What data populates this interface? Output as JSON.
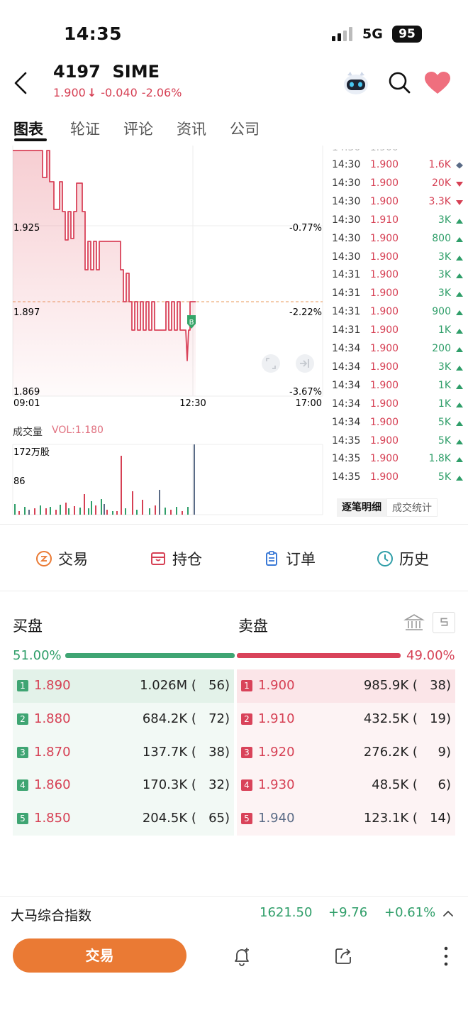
{
  "status_bar": {
    "time": "14:35",
    "network": "5G",
    "battery": "95"
  },
  "header": {
    "code": "4197  SIME",
    "price": "1.900",
    "arrow": "↓",
    "change": "-0.040",
    "change_pct": "-2.06%"
  },
  "tabs": [
    "图表",
    "轮证",
    "评论",
    "资讯",
    "公司"
  ],
  "price_chart": {
    "y_labels": [
      "1.925",
      "1.897",
      "1.869"
    ],
    "y_pct_labels": [
      "-0.77%",
      "-2.22%",
      "-3.67%"
    ],
    "x_labels": [
      "09:01",
      "12:30",
      "17:00"
    ],
    "marker": "B"
  },
  "volume": {
    "title": "成交量",
    "value": "VOL:1.180",
    "y_labels": [
      "172万股",
      "86"
    ]
  },
  "ticks": [
    {
      "time": "14:30",
      "price": "1.900",
      "vol": "1.6K",
      "dir": "neutral"
    },
    {
      "time": "14:30",
      "price": "1.900",
      "vol": "20K",
      "dir": "down"
    },
    {
      "time": "14:30",
      "price": "1.900",
      "vol": "3.3K",
      "dir": "down"
    },
    {
      "time": "14:30",
      "price": "1.910",
      "vol": "3K",
      "dir": "up"
    },
    {
      "time": "14:30",
      "price": "1.900",
      "vol": "800",
      "dir": "up"
    },
    {
      "time": "14:30",
      "price": "1.900",
      "vol": "3K",
      "dir": "up"
    },
    {
      "time": "14:31",
      "price": "1.900",
      "vol": "3K",
      "dir": "up"
    },
    {
      "time": "14:31",
      "price": "1.900",
      "vol": "3K",
      "dir": "up"
    },
    {
      "time": "14:31",
      "price": "1.900",
      "vol": "900",
      "dir": "up"
    },
    {
      "time": "14:31",
      "price": "1.900",
      "vol": "1K",
      "dir": "up"
    },
    {
      "time": "14:34",
      "price": "1.900",
      "vol": "200",
      "dir": "up"
    },
    {
      "time": "14:34",
      "price": "1.900",
      "vol": "3K",
      "dir": "up"
    },
    {
      "time": "14:34",
      "price": "1.900",
      "vol": "1K",
      "dir": "up"
    },
    {
      "time": "14:34",
      "price": "1.900",
      "vol": "1K",
      "dir": "up"
    },
    {
      "time": "14:34",
      "price": "1.900",
      "vol": "5K",
      "dir": "up"
    },
    {
      "time": "14:35",
      "price": "1.900",
      "vol": "5K",
      "dir": "up"
    },
    {
      "time": "14:35",
      "price": "1.900",
      "vol": "1.8K",
      "dir": "up"
    },
    {
      "time": "14:35",
      "price": "1.900",
      "vol": "5K",
      "dir": "up"
    }
  ],
  "tick_tabs": [
    "逐笔明细",
    "成交统计"
  ],
  "actions": [
    "交易",
    "持仓",
    "订单",
    "历史"
  ],
  "orderbook": {
    "buy_title": "买盘",
    "sell_title": "卖盘",
    "buy_pct": "51.00%",
    "sell_pct": "49.00%",
    "buy_ratio": 0.51,
    "bids": [
      {
        "n": "1",
        "price": "1.890",
        "vol": "1.026M (   56)"
      },
      {
        "n": "2",
        "price": "1.880",
        "vol": "684.2K (   72)"
      },
      {
        "n": "3",
        "price": "1.870",
        "vol": "137.7K (   38)"
      },
      {
        "n": "4",
        "price": "1.860",
        "vol": "170.3K (   32)"
      },
      {
        "n": "5",
        "price": "1.850",
        "vol": "204.5K (   65)"
      }
    ],
    "asks": [
      {
        "n": "1",
        "price": "1.900",
        "vol": "985.9K (   38)"
      },
      {
        "n": "2",
        "price": "1.910",
        "vol": "432.5K (   19)"
      },
      {
        "n": "3",
        "price": "1.920",
        "vol": "276.2K (     9)"
      },
      {
        "n": "4",
        "price": "1.930",
        "vol": "48.5K (     6)"
      },
      {
        "n": "5",
        "price": "1.940",
        "vol": "123.1K (   14)"
      }
    ]
  },
  "index": {
    "name": "大马综合指数",
    "value": "1621.50",
    "change": "+9.76",
    "change_pct": "+0.61%"
  },
  "bottom": {
    "trade": "交易"
  },
  "colors": {
    "down_red": "#d64054",
    "up_green": "#2f9e69",
    "accent_orange": "#ea7a34"
  }
}
